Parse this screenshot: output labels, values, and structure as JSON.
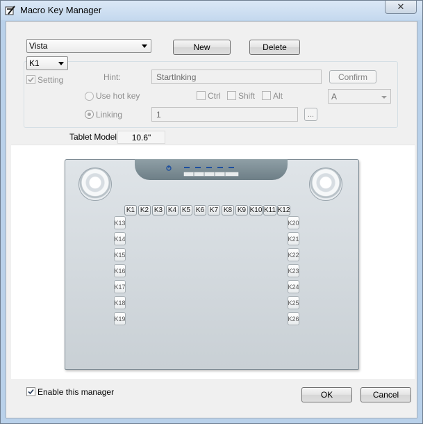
{
  "window": {
    "title": "Macro Key Manager",
    "close_glyph": "✕"
  },
  "profile_select": {
    "value": "Vista"
  },
  "toolbar": {
    "new_label": "New",
    "delete_label": "Delete"
  },
  "key_select": {
    "value": "K1"
  },
  "settings": {
    "setting_label": "Setting",
    "hint_label": "Hint:",
    "hint_value": "StartInking",
    "confirm_label": "Confirm",
    "hotkey_label": "Use hot key",
    "ctrl_label": "Ctrl",
    "shift_label": "Shift",
    "alt_label": "Alt",
    "hotkey_key_value": "A",
    "linking_label": "Linking",
    "linking_value": "1",
    "browse_label": "..."
  },
  "tablet": {
    "model_label": "Tablet Model:",
    "model_value": "10.6\"",
    "top_keys": [
      "K1",
      "K2",
      "K3",
      "K4",
      "K5",
      "K6",
      "K7",
      "K8",
      "K9",
      "K10",
      "K11",
      "K12"
    ],
    "left_keys": [
      "K13",
      "K14",
      "K15",
      "K16",
      "K17",
      "K18",
      "K19"
    ],
    "right_keys": [
      "K20",
      "K21",
      "K22",
      "K23",
      "K24",
      "K25",
      "K26"
    ]
  },
  "footer": {
    "enable_label": "Enable this manager",
    "ok_label": "OK",
    "cancel_label": "Cancel"
  }
}
